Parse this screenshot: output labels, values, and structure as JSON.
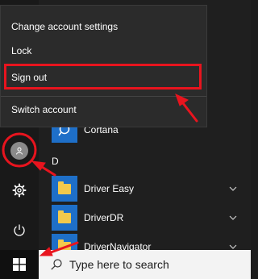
{
  "context_menu": {
    "items": [
      {
        "label": "Change account settings"
      },
      {
        "label": "Lock"
      },
      {
        "label": "Sign out"
      },
      {
        "label": "Switch account"
      }
    ]
  },
  "start_menu": {
    "pinned_app": {
      "label": "Cortana"
    },
    "section_letter": "D",
    "apps": [
      {
        "label": "Driver Easy",
        "icon": "folder-icon",
        "expandable": true
      },
      {
        "label": "DriverDR",
        "icon": "folder-icon",
        "expandable": true
      },
      {
        "label": "DriverNavigator",
        "icon": "folder-icon",
        "expandable": true
      }
    ]
  },
  "taskbar": {
    "search_placeholder": "Type here to search"
  },
  "colors": {
    "highlight_red": "#e8141e",
    "tile_blue": "#1e6fc8",
    "folder_yellow": "#f2c94c"
  },
  "icons": [
    "user-avatar-icon",
    "settings-gear-icon",
    "power-icon",
    "windows-logo-icon",
    "search-icon",
    "chevron-down-icon",
    "cortana-icon"
  ]
}
